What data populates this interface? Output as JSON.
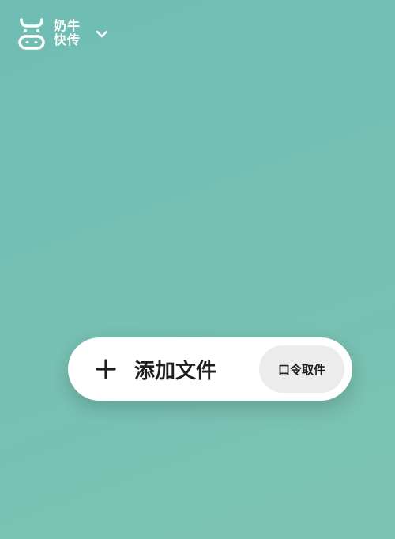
{
  "header": {
    "brand_line1": "奶牛",
    "brand_line2": "快传",
    "logo_icon": "cow-icon",
    "menu_icon": "chevron-down-icon"
  },
  "main": {
    "add_file_label": "添加文件",
    "add_icon": "plus-icon",
    "code_receive_label": "口令取件"
  },
  "colors": {
    "background_start": "#6fbdb3",
    "background_end": "#7cc3b1",
    "pill_background": "#ffffff",
    "secondary_button_background": "#ececec",
    "text_dark": "#1f1f1f",
    "brand_text": "#ffffff"
  }
}
